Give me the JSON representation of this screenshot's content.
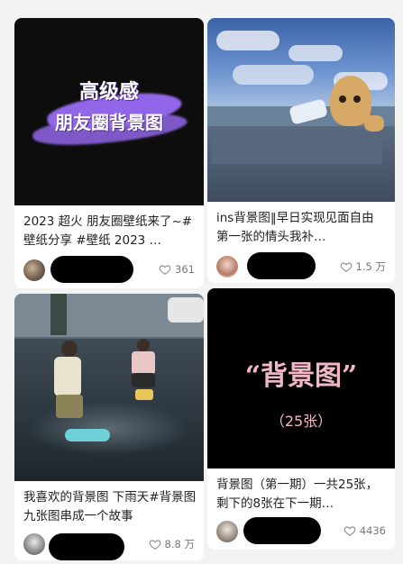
{
  "cards": [
    {
      "cover_title_line1": "高级感",
      "cover_title_line2": "朋友圈背景图",
      "caption": "2023 超火 朋友圈壁纸来了~#壁纸分享 #壁纸 2023 …",
      "likes": "361"
    },
    {
      "caption": "ins背景图‖早日实现见面自由 第一张的情头我补…",
      "likes": "1.5 万"
    },
    {
      "caption": "我喜欢的背景图 下雨天#背景图 九张图串成一个故事",
      "likes": "8.8 万"
    },
    {
      "cover_title": "“背景图”",
      "cover_sub": "（25张）",
      "caption": "背景图（第一期）一共25张，剩下的8张在下一期…",
      "likes": "4436"
    }
  ],
  "icons": {
    "like": "heart-outline-icon"
  },
  "colors": {
    "cover_purple": "#9266e8",
    "cover_pink": "#f2b8c6"
  }
}
